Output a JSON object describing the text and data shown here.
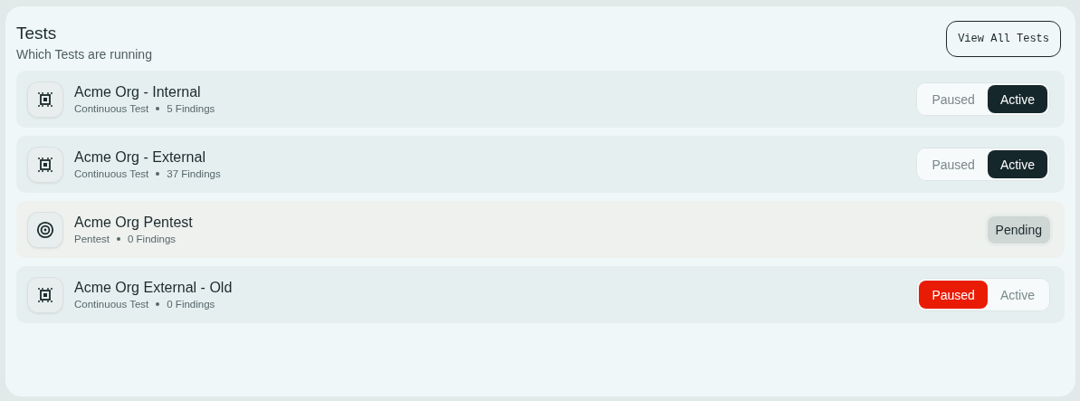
{
  "header": {
    "title": "Tests",
    "subtitle": "Which Tests are running",
    "button": "View All Tests"
  },
  "tests": [
    {
      "kind": "continuous",
      "name": "Acme Org - Internal",
      "type": "Continuous Test",
      "findings": "5 Findings",
      "options": [
        {
          "label": "Paused",
          "kind": "paused",
          "selected": false
        },
        {
          "label": "Active",
          "kind": "active",
          "selected": true
        }
      ]
    },
    {
      "kind": "continuous",
      "name": "Acme Org - External",
      "type": "Continuous Test",
      "findings": "37 Findings",
      "options": [
        {
          "label": "Paused",
          "kind": "paused",
          "selected": false
        },
        {
          "label": "Active",
          "kind": "active",
          "selected": true
        }
      ]
    },
    {
      "kind": "pentest",
      "name": "Acme Org Pentest",
      "type": "Pentest",
      "findings": "0 Findings",
      "status": "Pending"
    },
    {
      "kind": "continuous",
      "name": "Acme Org External - Old",
      "type": "Continuous Test",
      "findings": "0 Findings",
      "options": [
        {
          "label": "Paused",
          "kind": "paused",
          "selected": true
        },
        {
          "label": "Active",
          "kind": "active",
          "selected": false
        }
      ]
    }
  ]
}
